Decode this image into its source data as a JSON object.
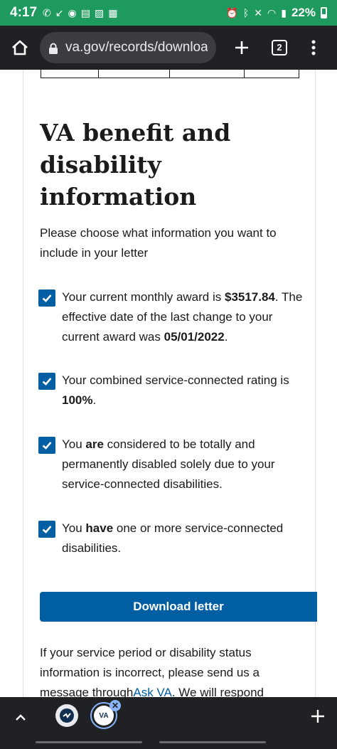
{
  "status_bar": {
    "time": "4:17",
    "battery": "22%",
    "left_icons": [
      "phone-call-icon",
      "missed-call-icon",
      "chrome-icon",
      "gallery-icon",
      "image-icon",
      "calendar-icon"
    ],
    "right_icons": [
      "alarm-icon",
      "bluetooth-icon",
      "mute-icon",
      "wifi-icon",
      "signal-icon",
      "battery-icon"
    ]
  },
  "browser": {
    "url": "va.gov/records/downloa",
    "tab_count": "2"
  },
  "page": {
    "heading": "VA benefit and disability information",
    "intro": "Please choose what information you want to include in your letter",
    "options": [
      {
        "checked": true,
        "t1": "Your current monthly award is ",
        "b1": "$3517.84",
        "t2": ". The effective date of the last change to your current award was ",
        "b2": "05/01/2022",
        "t3": "."
      },
      {
        "checked": true,
        "t1": "Your combined service-connected rating is ",
        "b1": "100%",
        "t2": "."
      },
      {
        "checked": true,
        "t1": "You ",
        "b1": "are",
        "t2": " considered to be totally and permanently disabled solely due to your service-connected disabilities."
      },
      {
        "checked": true,
        "t1": "You ",
        "b1": "have",
        "t2": " one or more service-connected disabilities."
      }
    ],
    "download_button": "Download letter",
    "footer_before_link": "If your service period or disability status information is incorrect, please send us a message through",
    "footer_link": "Ask VA",
    "footer_after_link": ". We will respond"
  },
  "tab_strip": {
    "active_tab_label": "VA"
  }
}
